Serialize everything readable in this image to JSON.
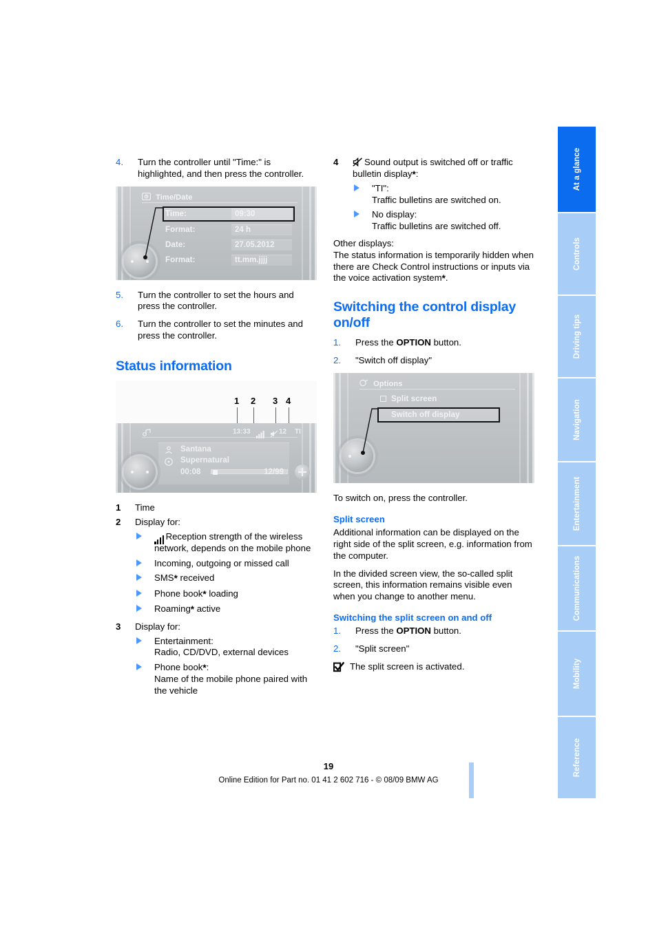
{
  "page": {
    "number": "19",
    "footer": "Online Edition for Part no. 01 41 2 602 716 - © 08/09 BMW AG",
    "accent_color": "#0b6cf0",
    "tab_color": "#a8cdf7"
  },
  "sidebar": {
    "tabs": [
      {
        "label": "At a glance",
        "active": true
      },
      {
        "label": "Controls",
        "active": false
      },
      {
        "label": "Driving tips",
        "active": false
      },
      {
        "label": "Navigation",
        "active": false
      },
      {
        "label": "Entertainment",
        "active": false
      },
      {
        "label": "Communications",
        "active": false
      },
      {
        "label": "Mobility",
        "active": false
      },
      {
        "label": "Reference",
        "active": false
      }
    ]
  },
  "left_column": {
    "steps_top": [
      {
        "num": "4.",
        "text": "Turn the controller until \"Time:\" is highlighted, and then press the controller."
      },
      {
        "num": "5.",
        "text": "Turn the controller to set the hours and press the controller."
      },
      {
        "num": "6.",
        "text": "Turn the controller to set the minutes and press the controller."
      }
    ],
    "timedate_screen": {
      "title": "Time/Date",
      "rows": [
        {
          "label": "Time:",
          "value": "09:30",
          "selected": true
        },
        {
          "label": "Format:",
          "value": "24 h",
          "selected": false
        },
        {
          "label": "Date:",
          "value": "27.05.2012",
          "selected": false
        },
        {
          "label": "Format:",
          "value": "tt.mm.jjjj",
          "selected": false
        }
      ]
    },
    "status_heading": "Status information",
    "status_screen": {
      "callouts": [
        "1",
        "2",
        "3",
        "4"
      ],
      "statusbar": {
        "time": "13:33",
        "signal": "signal-bars-icon",
        "compass_value": "12",
        "ti": "TI"
      },
      "now_playing": {
        "artist": "Santana",
        "album": "Supernatural",
        "elapsed": "00:08",
        "track": "12/99"
      }
    },
    "legend": [
      {
        "num": "1",
        "text": "Time",
        "items": []
      },
      {
        "num": "2",
        "text": "Display for:",
        "items": [
          {
            "icon": "signal-bars-icon",
            "text": "Reception strength of the wireless network, depends on the mobile phone"
          },
          {
            "icon": null,
            "text": "Incoming, outgoing or missed call"
          },
          {
            "icon": null,
            "text": "SMS* received"
          },
          {
            "icon": null,
            "text": "Phone book* loading"
          },
          {
            "icon": null,
            "text": "Roaming* active"
          }
        ]
      },
      {
        "num": "3",
        "text": "Display for:",
        "items": [
          {
            "icon": null,
            "text": "Entertainment:\nRadio, CD/DVD, external devices"
          },
          {
            "icon": null,
            "text": "Phone book*:\nName of the mobile phone paired with the vehicle"
          }
        ]
      }
    ]
  },
  "right_column": {
    "legend_item4": {
      "num": "4",
      "icon": "mute-icon",
      "text": "Sound output is switched off or traffic bulletin display*:",
      "items": [
        {
          "text": "\"TI\":\nTraffic bulletins are switched on."
        },
        {
          "text": "No display:\nTraffic bulletins are switched off."
        }
      ]
    },
    "other_displays": {
      "label": "Other displays:",
      "text": "The status information is temporarily hidden when there are Check Control instructions or inputs via the voice activation system*."
    },
    "control_display_heading": "Switching the control display on/off",
    "control_display_steps": [
      {
        "num": "1.",
        "pre": "Press the ",
        "strong": "OPTION",
        "post": " button."
      },
      {
        "num": "2.",
        "pre": "\"Switch off display\"",
        "strong": "",
        "post": ""
      }
    ],
    "options_screen": {
      "title": "Options",
      "rows": [
        {
          "label": "Split screen",
          "checkbox": true,
          "selected": false
        },
        {
          "label": "Switch off display",
          "checkbox": false,
          "selected": true
        }
      ]
    },
    "switch_on_note": "To switch on, press the controller.",
    "split_screen_heading": "Split screen",
    "split_screen_p1": "Additional information can be displayed on the right side of the split screen, e.g. information from the computer.",
    "split_screen_p2": "In the divided screen view, the so-called split screen, this information remains visible even when you change to another menu.",
    "switch_split_heading": "Switching the split screen on and off",
    "switch_split_steps": [
      {
        "num": "1.",
        "pre": "Press the ",
        "strong": "OPTION",
        "post": " button."
      },
      {
        "num": "2.",
        "pre": "\"Split screen\"",
        "strong": "",
        "post": ""
      }
    ],
    "split_result": "The split screen is activated."
  }
}
